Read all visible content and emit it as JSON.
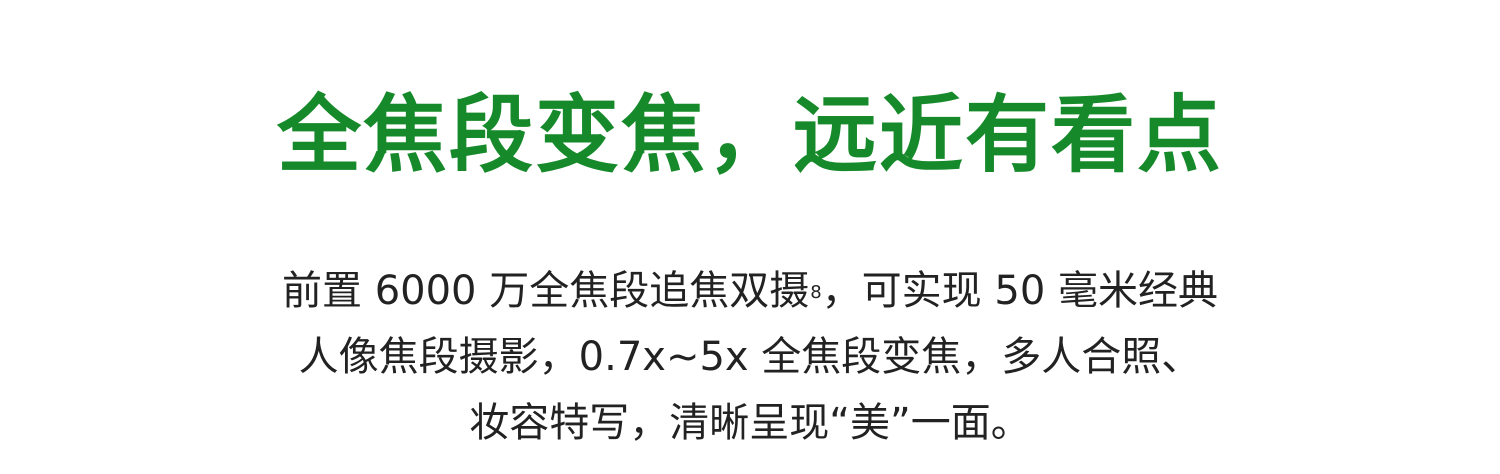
{
  "headline": {
    "text": "全焦段变焦，远近有看点",
    "color": "#168a2a"
  },
  "body": {
    "line1_before_footnote": "前置 6000 万全焦段追焦双摄",
    "line1_footnote_mark": "8",
    "line1_after_footnote": "，可实现 50 毫米经典",
    "line2": "人像焦段摄影，0.7x~5x 全焦段变焦，多人合照、",
    "line3": "妆容特写，清晰呈现“美”一面。",
    "color": "#222222"
  }
}
